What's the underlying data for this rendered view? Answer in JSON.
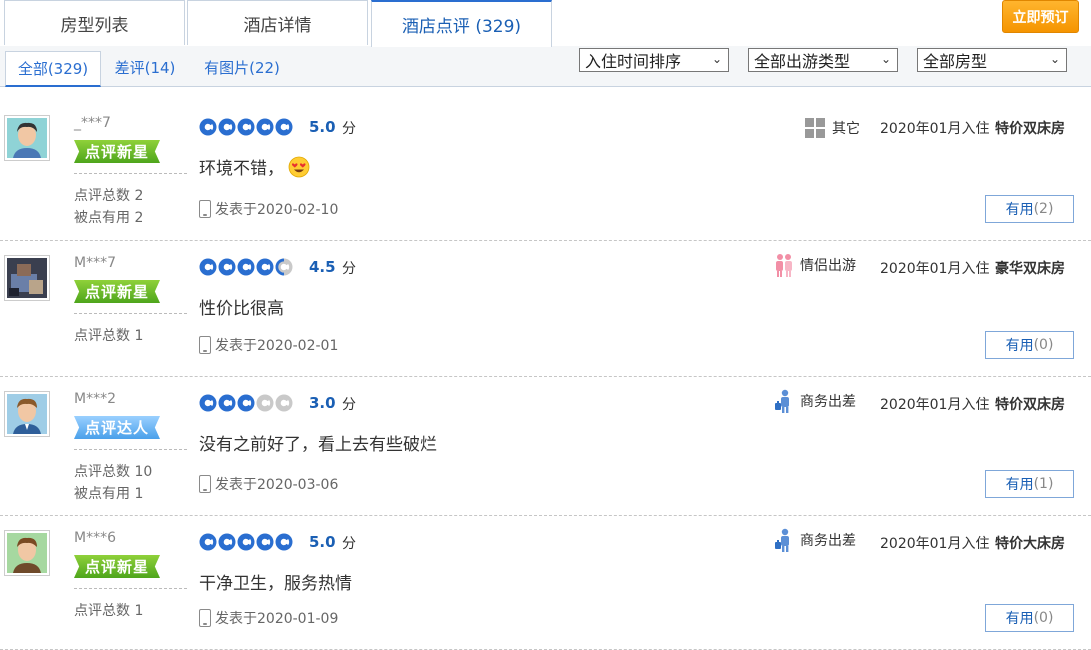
{
  "tabs": [
    {
      "label": "房型列表"
    },
    {
      "label": "酒店详情"
    },
    {
      "label": "酒店点评 (329)"
    }
  ],
  "book_button": "立即预订",
  "sub_tabs": [
    {
      "label": "全部(329)"
    },
    {
      "label": "差评(14)"
    },
    {
      "label": "有图片(22)"
    }
  ],
  "filters": {
    "sort": "入住时间排序",
    "trip_type": "全部出游类型",
    "room_type": "全部房型"
  },
  "score_unit": "分",
  "reviews": [
    {
      "username": "_***7",
      "badge": "点评新星",
      "badge_color": "green",
      "stat1": "点评总数 2",
      "stat2": "被点有用 2",
      "rating": 5,
      "score": "5.0",
      "content": "环境不错，",
      "emoji": "heart-eyes",
      "posted": "发表于2020-02-10",
      "trip_type": "其它",
      "checkin": "2020年01月入住",
      "room": "特价双床房",
      "useful_label": "有用",
      "useful_count": "(2)"
    },
    {
      "username": "M***7",
      "badge": "点评新星",
      "badge_color": "green",
      "stat1": "点评总数 1",
      "stat2": "",
      "rating": 4.5,
      "score": "4.5",
      "content": "性价比很高",
      "emoji": "",
      "posted": "发表于2020-02-01",
      "trip_type": "情侣出游",
      "checkin": "2020年01月入住",
      "room": "豪华双床房",
      "useful_label": "有用",
      "useful_count": "(0)"
    },
    {
      "username": "M***2",
      "badge": "点评达人",
      "badge_color": "blue",
      "stat1": "点评总数 10",
      "stat2": "被点有用 1",
      "rating": 3,
      "score": "3.0",
      "content": "没有之前好了，看上去有些破烂",
      "emoji": "",
      "posted": "发表于2020-03-06",
      "trip_type": "商务出差",
      "checkin": "2020年01月入住",
      "room": "特价双床房",
      "useful_label": "有用",
      "useful_count": "(1)"
    },
    {
      "username": "M***6",
      "badge": "点评新星",
      "badge_color": "green",
      "stat1": "点评总数 1",
      "stat2": "",
      "rating": 5,
      "score": "5.0",
      "content": "干净卫生，服务热情",
      "emoji": "",
      "posted": "发表于2020-01-09",
      "trip_type": "商务出差",
      "checkin": "2020年01月入住",
      "room": "特价大床房",
      "useful_label": "有用",
      "useful_count": "(0)"
    }
  ],
  "colors": {
    "accent_blue": "#1a5fb4",
    "book_orange": "#f59400",
    "badge_green": "#4ea51c",
    "badge_blue": "#4aa0ea"
  }
}
